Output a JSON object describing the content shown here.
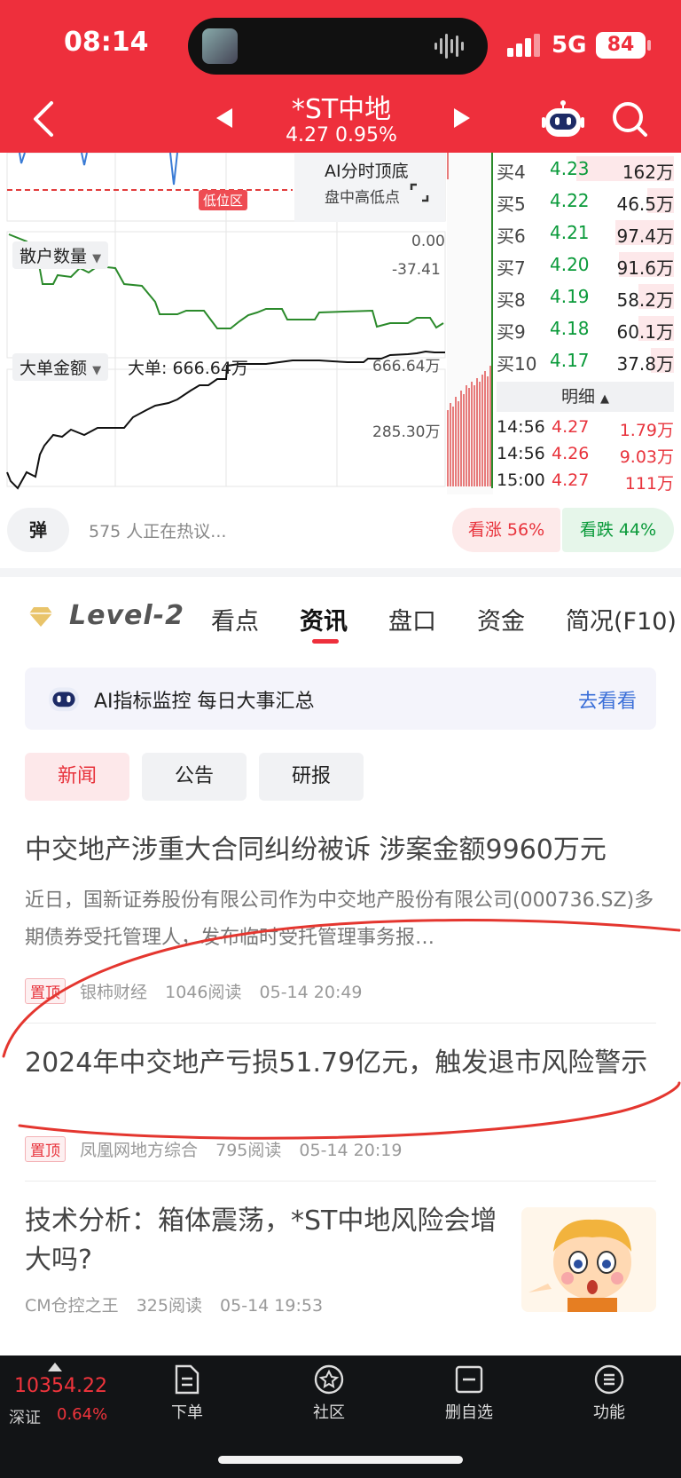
{
  "status_bar": {
    "time": "08:14",
    "network": "5G",
    "battery": "84"
  },
  "header": {
    "stock_name": "*ST中地",
    "quote": "4.27 0.95%"
  },
  "chart": {
    "ai_box_title": "AI分时顶底",
    "ai_box_sub": "盘中高低点",
    "low_zone": "低位区",
    "retail_label": "散户数量",
    "retail_top": "0.00",
    "retail_mid": "-37.41",
    "bigorder_label": "大单金额",
    "bigorder_value": "大单: 666.64万",
    "bigorder_top": "666.64万",
    "bigorder_mid": "285.30万"
  },
  "order_book": [
    {
      "label": "买4",
      "price": "4.23",
      "volume": "162万",
      "fill": 0.55
    },
    {
      "label": "买5",
      "price": "4.22",
      "volume": "46.5万",
      "fill": 0.15
    },
    {
      "label": "买6",
      "price": "4.21",
      "volume": "97.4万",
      "fill": 0.33
    },
    {
      "label": "买7",
      "price": "4.20",
      "volume": "91.6万",
      "fill": 0.31
    },
    {
      "label": "买8",
      "price": "4.19",
      "volume": "58.2万",
      "fill": 0.2
    },
    {
      "label": "买9",
      "price": "4.18",
      "volume": "60.1万",
      "fill": 0.2
    },
    {
      "label": "买10",
      "price": "4.17",
      "volume": "37.8万",
      "fill": 0.13
    }
  ],
  "detail": {
    "header": "明细",
    "rows": [
      {
        "time": "14:56",
        "price": "4.27",
        "volume": "1.79万"
      },
      {
        "time": "14:56",
        "price": "4.26",
        "volume": "9.03万"
      },
      {
        "time": "15:00",
        "price": "4.27",
        "volume": "111万"
      }
    ]
  },
  "sentiment": {
    "danmu": "弹",
    "hot_text": "575 人正在热议...",
    "bull": "看涨 56%",
    "bear": "看跌 44%"
  },
  "tabs": {
    "level2": "Level-2",
    "items": [
      "看点",
      "资讯",
      "盘口",
      "资金",
      "简况(F10)"
    ]
  },
  "ai_banner": {
    "text": "AI指标监控  每日大事汇总",
    "action": "去看看"
  },
  "subtabs": [
    "新闻",
    "公告",
    "研报"
  ],
  "news": [
    {
      "title": "中交地产涉重大合同纠纷被诉 涉案金额9960万元",
      "summary": "近日，国新证券股份有限公司作为中交地产股份有限公司(000736.SZ)多期债券受托管理人，发布临时受托管理事务报…",
      "pin": "置顶",
      "source": "银柿财经",
      "reads": "1046阅读",
      "time": "05-14 20:49"
    },
    {
      "title": "2024年中交地产亏损51.79亿元，触发退市风险警示",
      "pin": "置顶",
      "source": "凤凰网地方综合",
      "reads": "795阅读",
      "time": "05-14 20:19"
    },
    {
      "title": "技术分析：箱体震荡，*ST中地风险会增大吗?",
      "source": "CM仓控之王",
      "reads": "325阅读",
      "time": "05-14 19:53"
    }
  ],
  "bottom_bar": {
    "index_value": "10354.22",
    "index_name": "深证",
    "index_pct": "0.64%",
    "items": [
      "下单",
      "社区",
      "删自选",
      "功能"
    ]
  },
  "colors": {
    "header_red": "#ee2f3c",
    "rise": "#e8333c",
    "fall": "#0a9a3a",
    "link": "#3b6fd8"
  }
}
